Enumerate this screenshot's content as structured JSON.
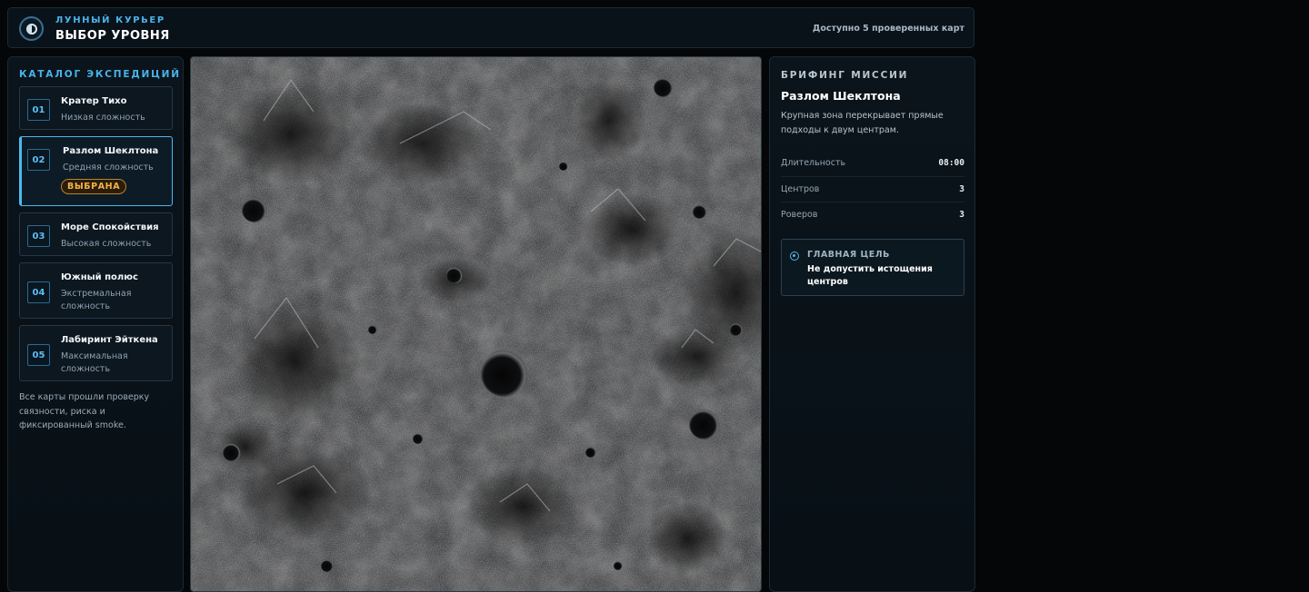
{
  "header": {
    "brand": "ЛУННЫЙ КУРЬЕР",
    "title": "ВЫБОР УРОВНЯ",
    "status": "Доступно 5 проверенных карт",
    "logo_icon": "moon-icon"
  },
  "catalog": {
    "title": "КАТАЛОГ ЭКСПЕДИЦИЙ",
    "levels": [
      {
        "num": "01",
        "name": "Кратер Тихо",
        "difficulty": "Низкая сложность"
      },
      {
        "num": "02",
        "name": "Разлом Шеклтона",
        "difficulty": "Средняя сложность",
        "badge": "ВЫБРАНА"
      },
      {
        "num": "03",
        "name": "Море Спокойствия",
        "difficulty": "Высокая сложность"
      },
      {
        "num": "04",
        "name": "Южный полюс",
        "difficulty": "Экстремальная сложность"
      },
      {
        "num": "05",
        "name": "Лабиринт Эйткена",
        "difficulty": "Максимальная сложность"
      }
    ],
    "note": "Все карты прошли проверку связности, риска и фиксированный smoke."
  },
  "briefing": {
    "title": "БРИФИНГ МИССИИ",
    "mission_name": "Разлом Шеклтона",
    "description": "Крупная зона перекрывает прямые подходы к двум центрам.",
    "stats": [
      {
        "label": "Длительность",
        "value": "08:00"
      },
      {
        "label": "Центров",
        "value": "3"
      },
      {
        "label": "Роверов",
        "value": "3"
      }
    ],
    "goal": {
      "title": "ГЛАВНАЯ ЦЕЛЬ",
      "text": "Не допустить истощения центров",
      "icon": "target-icon"
    }
  },
  "colors": {
    "accent": "#49b3ea",
    "badge": "#f4b347",
    "background": "#040608",
    "panel": "#0b141b"
  }
}
